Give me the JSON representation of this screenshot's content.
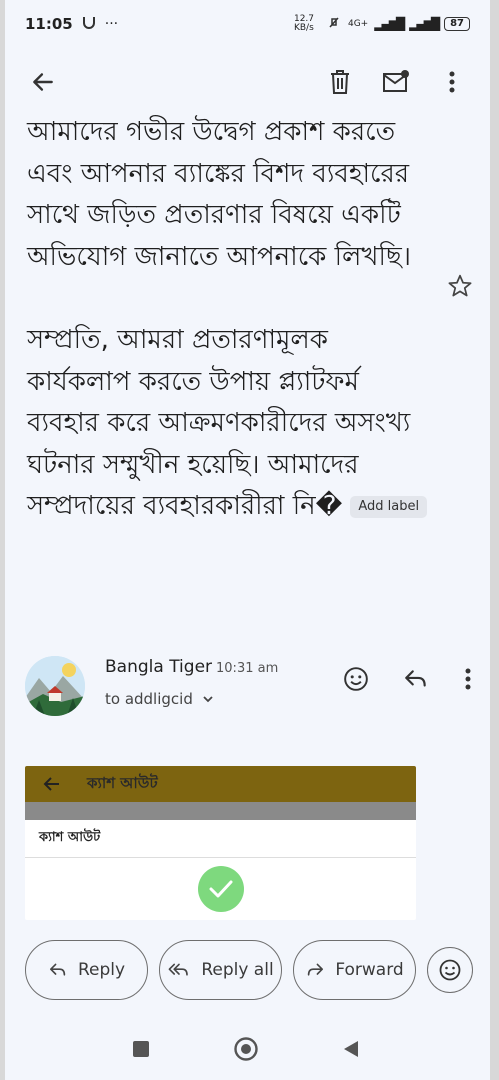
{
  "status_bar": {
    "time": "11:05",
    "net_speed": "12.7 KB/s",
    "network": "4G+",
    "battery": "87"
  },
  "toolbar": {
    "back_icon": "arrow-left-icon",
    "delete_icon": "trash-icon",
    "mark_unread_icon": "mail-unread-icon",
    "more_icon": "more-vert-icon"
  },
  "message": {
    "paragraph1": "আমাদের গভীর উদ্বেগ প্রকাশ করতে এবং আপনার ব্যাঙ্কের বিশদ ব্যবহারের সাথে জড়িত প্রতারণার বিষয়ে একটি অভিযোগ জানাতে আপনাকে লিখছি।",
    "paragraph2": "সম্প্রতি, আমরা প্রতারণামূলক কার্যকলাপ করতে উপায় প্ল্যাটফর্ম ব্যবহার করে আক্রমণকারীদের অসংখ্য ঘটনার সম্মুখীন হয়েছি। আমাদের সম্প্রদায়ের ব্যবহারকারীরা নি�",
    "add_label": "Add label"
  },
  "sender": {
    "name": "Bangla Tiger",
    "time": "10:31 am",
    "to": "to addligcid"
  },
  "attachment": {
    "header_title": "ক্যাশ আউট",
    "row_label": "ক্যাশ আউট"
  },
  "actions": {
    "reply": "Reply",
    "reply_all": "Reply all",
    "forward": "Forward"
  },
  "colors": {
    "background": "#f3f6fc",
    "attachment_header": "#7d6410",
    "check_green": "#7ed97e"
  }
}
